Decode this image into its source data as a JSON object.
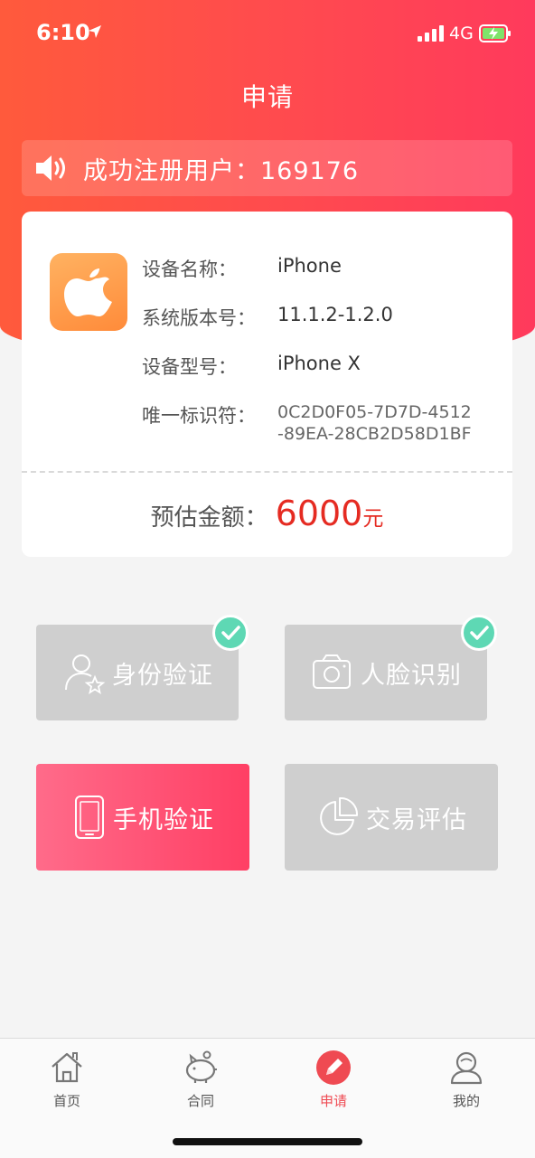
{
  "status": {
    "time": "6:10",
    "network": "4G"
  },
  "header": {
    "title": "申请"
  },
  "notice": {
    "text": "成功注册用户：169176"
  },
  "device": {
    "rows": [
      {
        "label": "设备名称：",
        "value": "iPhone"
      },
      {
        "label": "系统版本号：",
        "value": "11.1.2-1.2.0"
      },
      {
        "label": "设备型号：",
        "value": "iPhone X"
      },
      {
        "label": "唯一标识符：",
        "value_line1": "0C2D0F05-7D7D-4512",
        "value_line2": "-89EA-28CB2D58D1BF"
      }
    ],
    "estimate_label": "预估金额：",
    "estimate_value": "6000",
    "estimate_unit": "元"
  },
  "tiles": {
    "identity": {
      "label": "身份验证",
      "done": true
    },
    "face": {
      "label": "人脸识别",
      "done": true
    },
    "phone": {
      "label": "手机验证",
      "active": true
    },
    "trade": {
      "label": "交易评估"
    }
  },
  "tabbar": {
    "home": "首页",
    "contract": "合同",
    "apply": "申请",
    "mine": "我的"
  },
  "colors": {
    "accent": "#ff4a4f",
    "amount": "#e52b22",
    "check": "#5ed8b4",
    "active_tile": "#ff4f72"
  }
}
